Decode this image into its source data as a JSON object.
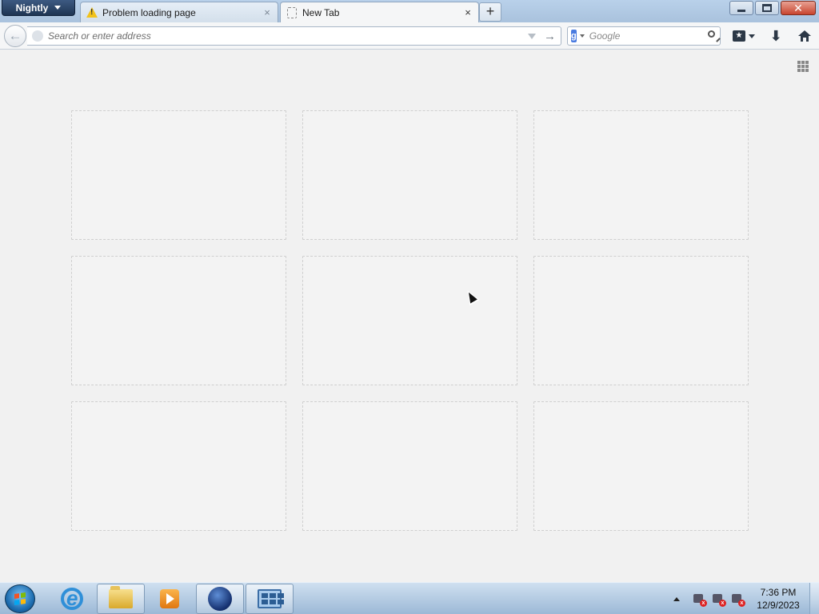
{
  "app_menu": {
    "label": "Nightly"
  },
  "tabs": [
    {
      "label": "Problem loading page",
      "icon": "warning-icon",
      "active": false
    },
    {
      "label": "New Tab",
      "icon": "blank-page-icon",
      "active": true
    }
  ],
  "tab_close_glyph": "×",
  "new_tab_glyph": "+",
  "window_controls": {
    "close_glyph": "✕"
  },
  "navbar": {
    "back_glyph": "←",
    "url_placeholder": "Search or enter address",
    "url_value": "",
    "go_glyph": "→",
    "search_engine_letter": "g",
    "search_placeholder": "Google",
    "bookmark_glyph": "★",
    "download_glyph": "⬇"
  },
  "newtab": {
    "tile_count": 9
  },
  "taskbar": {
    "apps": [
      "internet-explorer",
      "windows-explorer",
      "windows-media-player",
      "firefox-nightly",
      "remote-desktop"
    ],
    "clock_time": "7:36 PM",
    "clock_date": "12/9/2023"
  },
  "colors": {
    "titlebar": "#b9d1ea",
    "content_bg": "#f1f1f1",
    "close_button": "#c8452e",
    "app_menu": "#1f3553"
  }
}
